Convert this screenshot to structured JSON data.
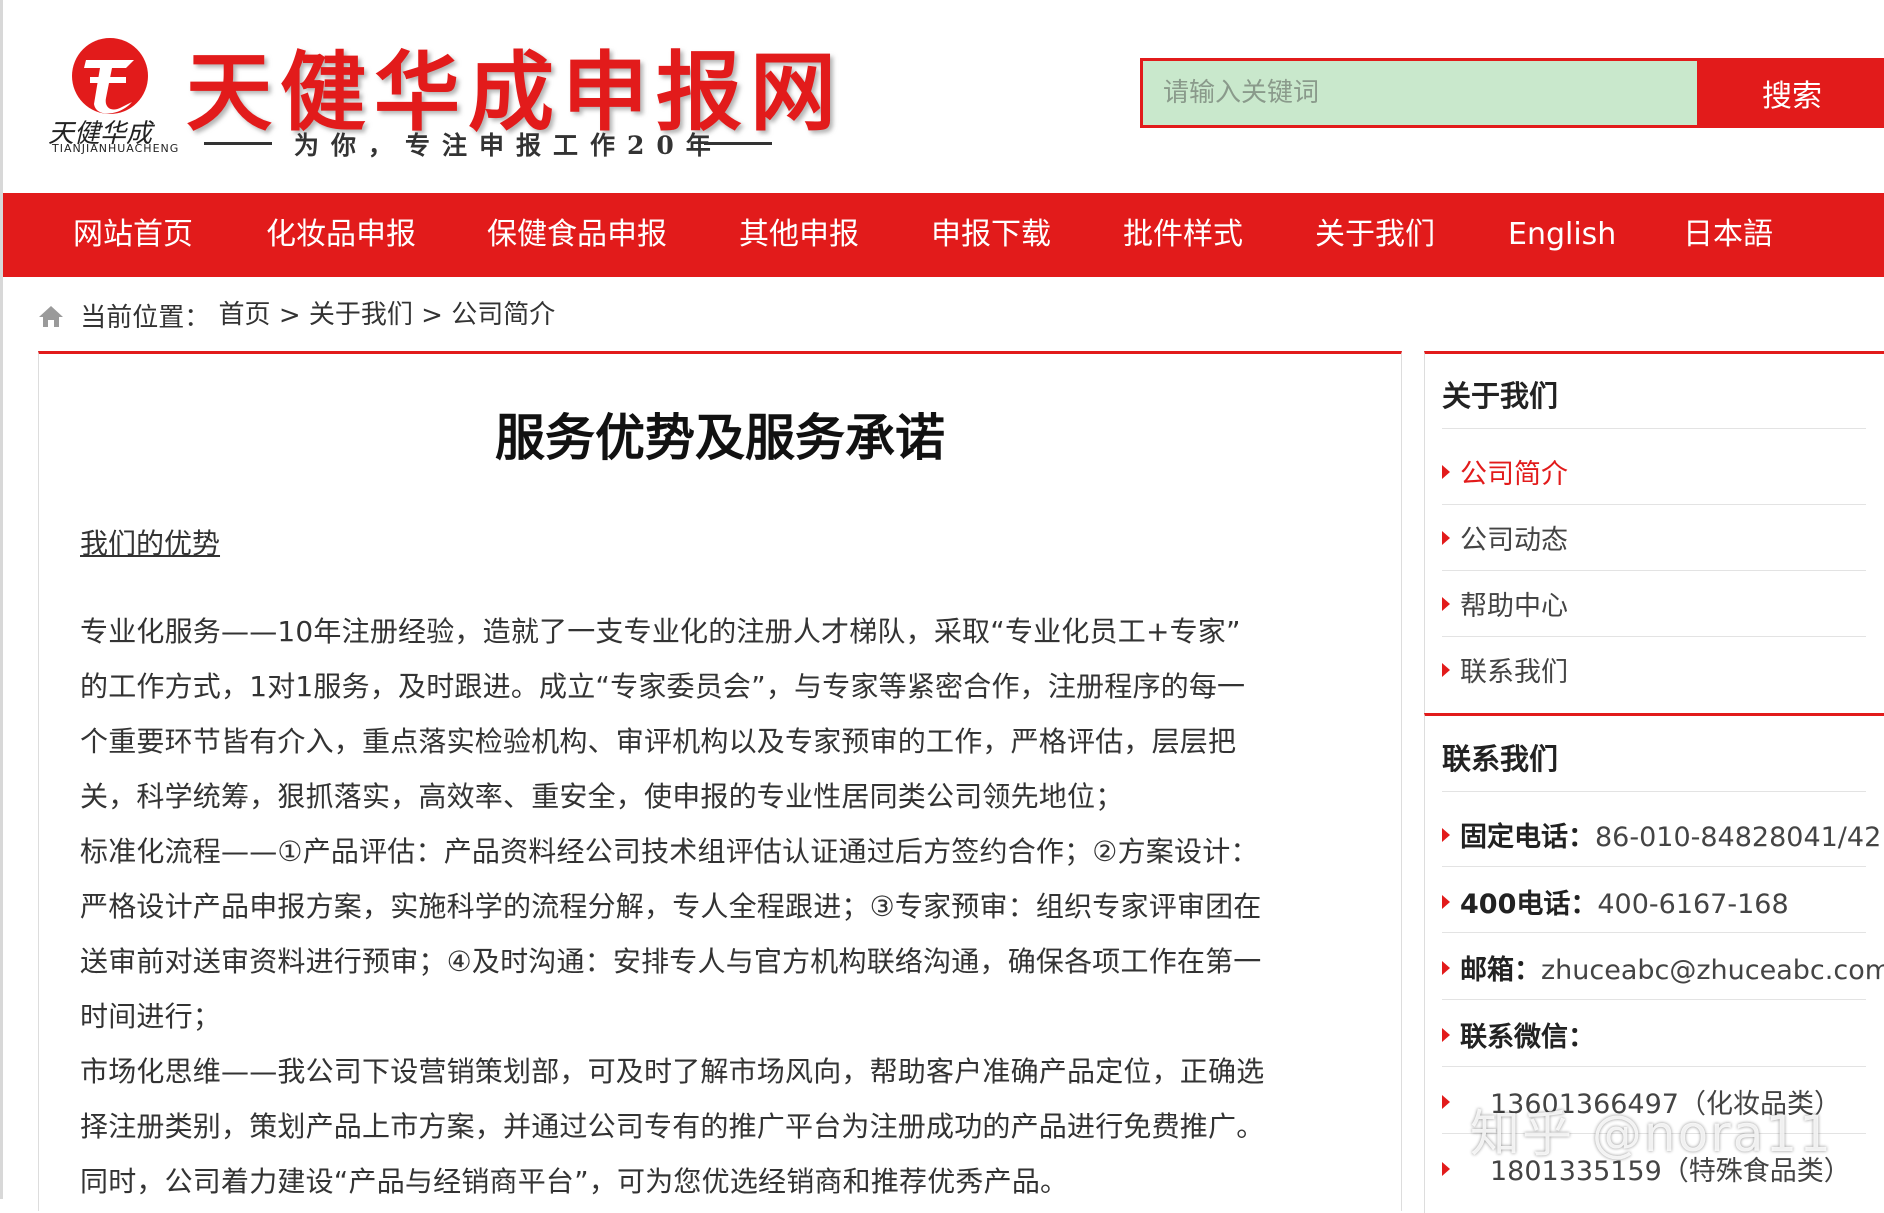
{
  "header": {
    "site_title": "天健华成申报网",
    "slogan": "为你，专注申报工作20年",
    "logo_text": "TIANJIANHUACHENG",
    "search_placeholder": "请输入关键词",
    "search_button": "搜索"
  },
  "nav": {
    "items": [
      {
        "label": "网站首页"
      },
      {
        "label": "化妆品申报"
      },
      {
        "label": "保健食品申报"
      },
      {
        "label": "其他申报"
      },
      {
        "label": "申报下载"
      },
      {
        "label": "批件样式"
      },
      {
        "label": "关于我们"
      },
      {
        "label": "English"
      },
      {
        "label": "日本語"
      }
    ]
  },
  "breadcrumb": {
    "prefix": "当前位置：",
    "home": "首页",
    "sep": " > ",
    "section": "关于我们",
    "current": "公司简介"
  },
  "article": {
    "title": "服务优势及服务承诺",
    "section_heading": "我们的优势",
    "lines": [
      "专业化服务——10年注册经验，造就了一支专业化的注册人才梯队，采取“专业化员工+专家”",
      "的工作方式，1对1服务，及时跟进。成立“专家委员会”，与专家等紧密合作，注册程序的每一",
      "个重要环节皆有介入，重点落实检验机构、审评机构以及专家预审的工作，严格评估，层层把",
      "关，科学统筹，狠抓落实，高效率、重安全，使申报的专业性居同类公司领先地位；",
      "标准化流程——①产品评估：产品资料经公司技术组评估认证通过后方签约合作；②方案设计：",
      "严格设计产品申报方案，实施科学的流程分解，专人全程跟进；③专家预审：组织专家评审团在",
      "送审前对送审资料进行预审；④及时沟通：安排专人与官方机构联络沟通，确保各项工作在第一",
      "时间进行；",
      "市场化思维——我公司下设营销策划部，可及时了解市场风向，帮助客户准确产品定位，正确选",
      "择注册类别，策划产品上市方案，并通过公司专有的推广平台为注册成功的产品进行免费推广。",
      "同时，公司着力建设“产品与经销商平台”，可为您优选经销商和推荐优秀产品。"
    ]
  },
  "sidebar": {
    "about_title": "关于我们",
    "about_items": [
      {
        "label": "公司简介"
      },
      {
        "label": "公司动态"
      },
      {
        "label": "帮助中心"
      },
      {
        "label": "联系我们"
      }
    ],
    "contact_title": "联系我们",
    "contacts": [
      {
        "key": "固定电话",
        "value": "86-010-84828041/42"
      },
      {
        "key": "400电话",
        "value": "400-6167-168"
      },
      {
        "key": "邮箱",
        "value": "zhuceabc@zhuceabc.com"
      },
      {
        "key": "联系微信",
        "value": ""
      }
    ],
    "wechat": [
      {
        "value": "13601366497（化妆品类）"
      },
      {
        "value": "1801335159（特殊食品类）"
      }
    ]
  },
  "watermark": "知乎 @nora11",
  "colors": {
    "brand_red": "#e21b1b",
    "search_bg": "#c9e8cc"
  }
}
